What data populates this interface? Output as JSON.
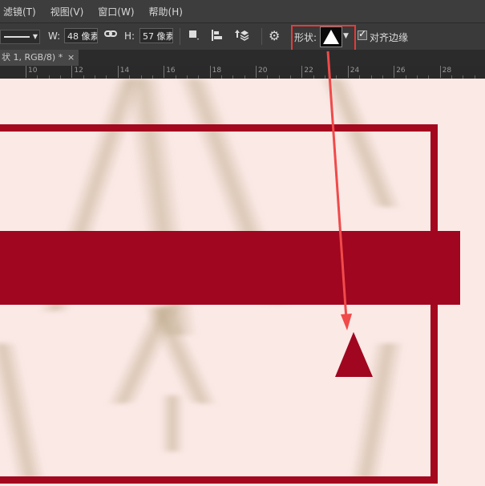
{
  "menu": [
    "滤镜(T)",
    "视图(V)",
    "窗口(W)",
    "帮助(H)"
  ],
  "options": {
    "width_label": "W:",
    "width_value": "48 像素",
    "height_label": "H:",
    "height_value": "57 像素",
    "shape_label": "形状:",
    "align_edges_label": "对齐边缘",
    "align_edges_checked": true
  },
  "document_tab": {
    "title": "状 1, RGB/8) *",
    "close": "×"
  },
  "ruler": {
    "labels": [
      "10",
      "12",
      "14",
      "16",
      "18",
      "20",
      "22",
      "24",
      "26",
      "28"
    ]
  },
  "colors": {
    "accent_red": "#a0061f",
    "highlight": "#e53b3b",
    "canvas_bg": "#fbe9e6"
  },
  "icons": [
    "link-icon",
    "path-operations-icon",
    "path-alignment-icon",
    "path-arrangement-icon",
    "gear-icon",
    "triangle-shape-icon",
    "checkbox-icon",
    "close-icon"
  ]
}
